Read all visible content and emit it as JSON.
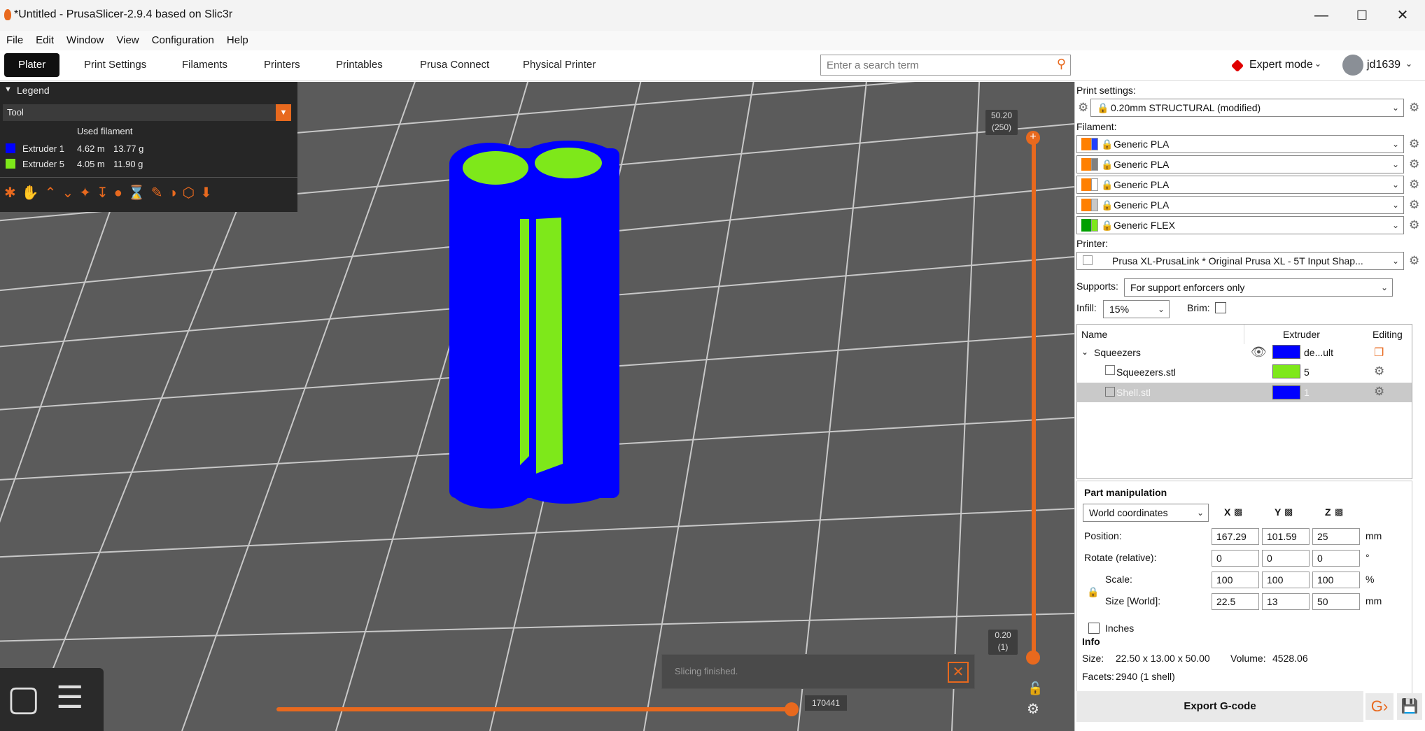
{
  "window": {
    "title": "*Untitled - PrusaSlicer-2.9.4 based on Slic3r"
  },
  "menu": [
    "File",
    "Edit",
    "Window",
    "View",
    "Configuration",
    "Help"
  ],
  "tabs": [
    "Plater",
    "Print Settings",
    "Filaments",
    "Printers",
    "Printables",
    "Prusa Connect",
    "Physical Printer"
  ],
  "search": {
    "placeholder": "Enter a search term"
  },
  "mode": {
    "label": "Expert mode"
  },
  "user": {
    "name": "jd1639"
  },
  "legend": {
    "title": "Legend",
    "view_type": "Tool",
    "header": "Used filament",
    "rows": [
      {
        "name": "Extruder 1",
        "length": "4.62 m",
        "weight": "13.77 g",
        "color": "#0000ff"
      },
      {
        "name": "Extruder 5",
        "length": "4.05 m",
        "weight": "11.90 g",
        "color": "#7ee81a"
      }
    ]
  },
  "vertical_slider": {
    "top_label": "50.20",
    "top_sub": "(250)",
    "bottom_label": "0.20",
    "bottom_sub": "(1)"
  },
  "horizontal_slider": {
    "value": "170441"
  },
  "notification": {
    "text": "Slicing finished."
  },
  "sidebar": {
    "print_settings_label": "Print settings:",
    "print_profile": "0.20mm STRUCTURAL (modified)",
    "filament_label": "Filament:",
    "filaments": [
      {
        "name": "Generic PLA",
        "c1": "#ff8000",
        "c2": "#1f3fff"
      },
      {
        "name": "Generic PLA",
        "c1": "#ff8000",
        "c2": "#808080"
      },
      {
        "name": "Generic PLA",
        "c1": "#ff8000",
        "c2": "#ffffff"
      },
      {
        "name": "Generic PLA",
        "c1": "#ff8000",
        "c2": "#c8c8c8"
      },
      {
        "name": "Generic FLEX",
        "c1": "#00a000",
        "c2": "#7ee81a"
      }
    ],
    "printer_label": "Printer:",
    "printer": "Prusa XL-PrusaLink * Original Prusa XL - 5T Input Shap...",
    "supports_label": "Supports:",
    "supports": "For support enforcers only",
    "infill_label": "Infill:",
    "infill": "15%",
    "brim_label": "Brim:",
    "object_list": {
      "headers": {
        "name": "Name",
        "extruder": "Extruder",
        "editing": "Editing"
      },
      "rows": [
        {
          "name": "Squeezers",
          "extruder": "de...ult",
          "color": "#0000ff"
        },
        {
          "name": "Squeezers.stl",
          "extruder": "5",
          "color": "#7ee81a"
        },
        {
          "name": "Shell.stl",
          "extruder": "1",
          "color": "#0000ff"
        }
      ]
    },
    "part_manipulation": {
      "title": "Part manipulation",
      "coord_system": "World coordinates",
      "axes": [
        "X",
        "Y",
        "Z"
      ],
      "rows": [
        {
          "label": "Position:",
          "x": "167.29",
          "y": "101.59",
          "z": "25",
          "unit": "mm"
        },
        {
          "label": "Rotate (relative):",
          "x": "0",
          "y": "0",
          "z": "0",
          "unit": "°"
        },
        {
          "label": "Scale:",
          "x": "100",
          "y": "100",
          "z": "100",
          "unit": "%"
        },
        {
          "label": "Size [World]:",
          "x": "22.5",
          "y": "13",
          "z": "50",
          "unit": "mm"
        }
      ],
      "inches_label": "Inches"
    },
    "info": {
      "title": "Info",
      "size_label": "Size:",
      "size": "22.50 x 13.00 x 50.00",
      "volume_label": "Volume:",
      "volume": "4528.06",
      "facets_label": "Facets:",
      "facets": "2940 (1 shell)"
    },
    "export_label": "Export G-code"
  }
}
